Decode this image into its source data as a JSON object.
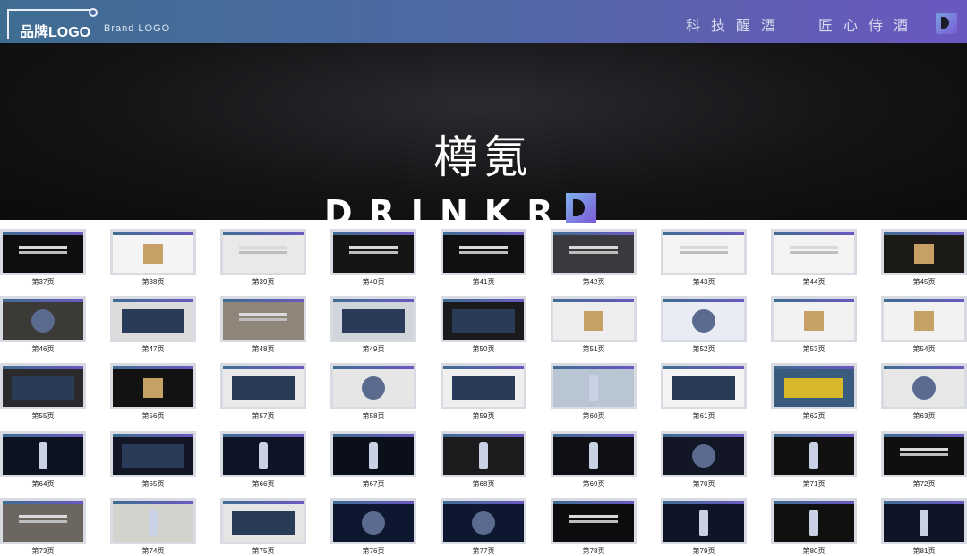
{
  "header": {
    "logo_cn": "品牌LOGO",
    "logo_en": "Brand LOGO",
    "slogan_1": "科技醒酒",
    "slogan_2": "匠心侍酒"
  },
  "hero": {
    "brand_cn": "樽氪",
    "brand_en": "DRINKR"
  },
  "thumbnails": [
    {
      "label": "第37页",
      "bg": "#0e0e10",
      "motif": "text"
    },
    {
      "label": "第38页",
      "bg": "#f4f4f4",
      "motif": "box"
    },
    {
      "label": "第39页",
      "bg": "#e9e9e9",
      "motif": "text"
    },
    {
      "label": "第40页",
      "bg": "#151515",
      "motif": "text"
    },
    {
      "label": "第41页",
      "bg": "#101012",
      "motif": "text"
    },
    {
      "label": "第42页",
      "bg": "#3a3a3e",
      "motif": "text"
    },
    {
      "label": "第43页",
      "bg": "#f3f3f3",
      "motif": "text"
    },
    {
      "label": "第44页",
      "bg": "#f3f3f3",
      "motif": "text"
    },
    {
      "label": "第45页",
      "bg": "#1c1a16",
      "motif": "box"
    },
    {
      "label": "第46页",
      "bg": "#3b3a37",
      "motif": "disc"
    },
    {
      "label": "第47页",
      "bg": "#dcdcdc",
      "motif": "panel"
    },
    {
      "label": "第48页",
      "bg": "#8f8578",
      "motif": "text"
    },
    {
      "label": "第49页",
      "bg": "#cfd5da",
      "motif": "panel"
    },
    {
      "label": "第50页",
      "bg": "#1a1a1c",
      "motif": "panel"
    },
    {
      "label": "第51页",
      "bg": "#eeeeee",
      "motif": "box"
    },
    {
      "label": "第52页",
      "bg": "#e9ecf5",
      "motif": "disc"
    },
    {
      "label": "第53页",
      "bg": "#f2f2f2",
      "motif": "box"
    },
    {
      "label": "第54页",
      "bg": "#f2f2f2",
      "motif": "box"
    },
    {
      "label": "第55页",
      "bg": "#2a2a2c",
      "motif": "panel"
    },
    {
      "label": "第56页",
      "bg": "#121212",
      "motif": "box"
    },
    {
      "label": "第57页",
      "bg": "#e9e9e9",
      "motif": "panel"
    },
    {
      "label": "第58页",
      "bg": "#e6e6e6",
      "motif": "disc"
    },
    {
      "label": "第59页",
      "bg": "#efefef",
      "motif": "panel"
    },
    {
      "label": "第60页",
      "bg": "#b7c6d2",
      "motif": "bottle"
    },
    {
      "label": "第61页",
      "bg": "#f4f4f4",
      "motif": "panel"
    },
    {
      "label": "第62页",
      "bg": "#385b7e",
      "motif": "truck"
    },
    {
      "label": "第63页",
      "bg": "#e7e7e7",
      "motif": "disc"
    },
    {
      "label": "第64页",
      "bg": "#0d1220",
      "motif": "bottle"
    },
    {
      "label": "第65页",
      "bg": "#131725",
      "motif": "panel"
    },
    {
      "label": "第66页",
      "bg": "#0e1426",
      "motif": "bottle"
    },
    {
      "label": "第67页",
      "bg": "#0b0f1a",
      "motif": "bottle"
    },
    {
      "label": "第68页",
      "bg": "#1c1c1e",
      "motif": "bottle"
    },
    {
      "label": "第69页",
      "bg": "#0f1016",
      "motif": "bottle"
    },
    {
      "label": "第70页",
      "bg": "#131624",
      "motif": "disc"
    },
    {
      "label": "第71页",
      "bg": "#111111",
      "motif": "bottle"
    },
    {
      "label": "第72页",
      "bg": "#0f0f10",
      "motif": "text"
    },
    {
      "label": "第73页",
      "bg": "#6b6660",
      "motif": "text"
    },
    {
      "label": "第74页",
      "bg": "#d4d2cc",
      "motif": "bottle"
    },
    {
      "label": "第75页",
      "bg": "#e5e5e5",
      "motif": "panel"
    },
    {
      "label": "第76页",
      "bg": "#0e1730",
      "motif": "disc"
    },
    {
      "label": "第77页",
      "bg": "#0e1730",
      "motif": "disc"
    },
    {
      "label": "第78页",
      "bg": "#0c0c0e",
      "motif": "text"
    },
    {
      "label": "第79页",
      "bg": "#0f1426",
      "motif": "bottle"
    },
    {
      "label": "第80页",
      "bg": "#101010",
      "motif": "bottle"
    },
    {
      "label": "第81页",
      "bg": "#0f1426",
      "motif": "bottle"
    }
  ]
}
